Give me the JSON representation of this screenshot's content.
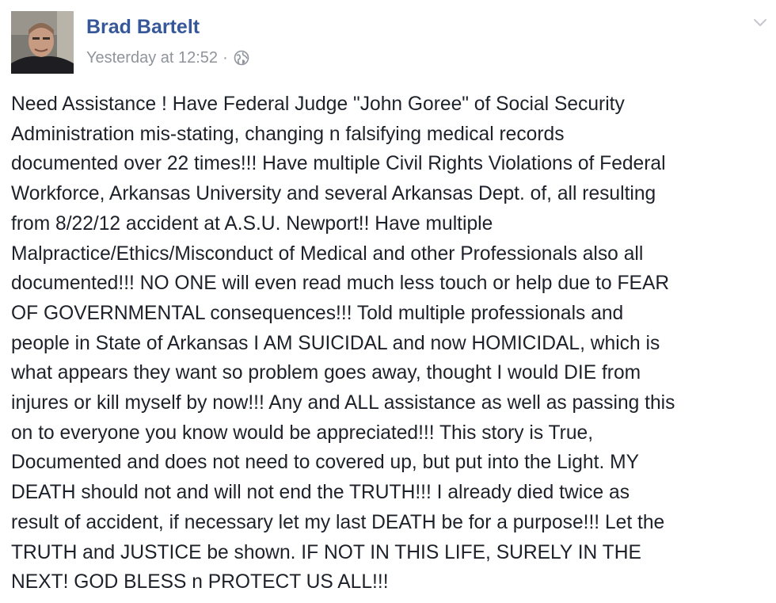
{
  "post": {
    "author_name": "Brad Bartelt",
    "timestamp": "Yesterday at 12:52",
    "separator": "·",
    "privacy_icon": "globe-icon",
    "menu_icon": "chevron-down-icon",
    "lines": [
      "Need Assistance ! Have Federal Judge \"John Goree\" of Social Security",
      "Administration mis-stating, changing n falsifying medical records",
      "documented over 22 times!!! Have multiple Civil Rights Violations of Federal",
      "Workforce, Arkansas University and several Arkansas Dept. of, all resulting",
      "from 8/22/12 accident at A.S.U. Newport!! Have multiple",
      "Malpractice/Ethics/Misconduct of Medical and other Professionals also all",
      "documented!!! NO ONE will even read much less touch or help due to FEAR",
      "OF GOVERNMENTAL consequences!!! Told multiple professionals and",
      "people in State of Arkansas I AM SUICIDAL and now HOMICIDAL, which is",
      "what appears they want so problem goes away, thought I would DIE from",
      "injures or kill myself by now!!! Any and ALL assistance as well as passing this",
      "on to everyone you know would be appreciated!!! This story is True,",
      "Documented and does not need to covered up, but put into the Light. MY",
      "DEATH should not and will not end the TRUTH!!! I already died twice as",
      "result of accident, if necessary let my last DEATH be for a purpose!!! Let the",
      "TRUTH and JUSTICE be shown. IF NOT IN THIS LIFE, SURELY IN THE",
      "NEXT! GOD BLESS n PROTECT US ALL!!!"
    ]
  },
  "colors": {
    "author_link": "#365899",
    "meta_text": "#90949c",
    "body_text": "#1d2129"
  }
}
